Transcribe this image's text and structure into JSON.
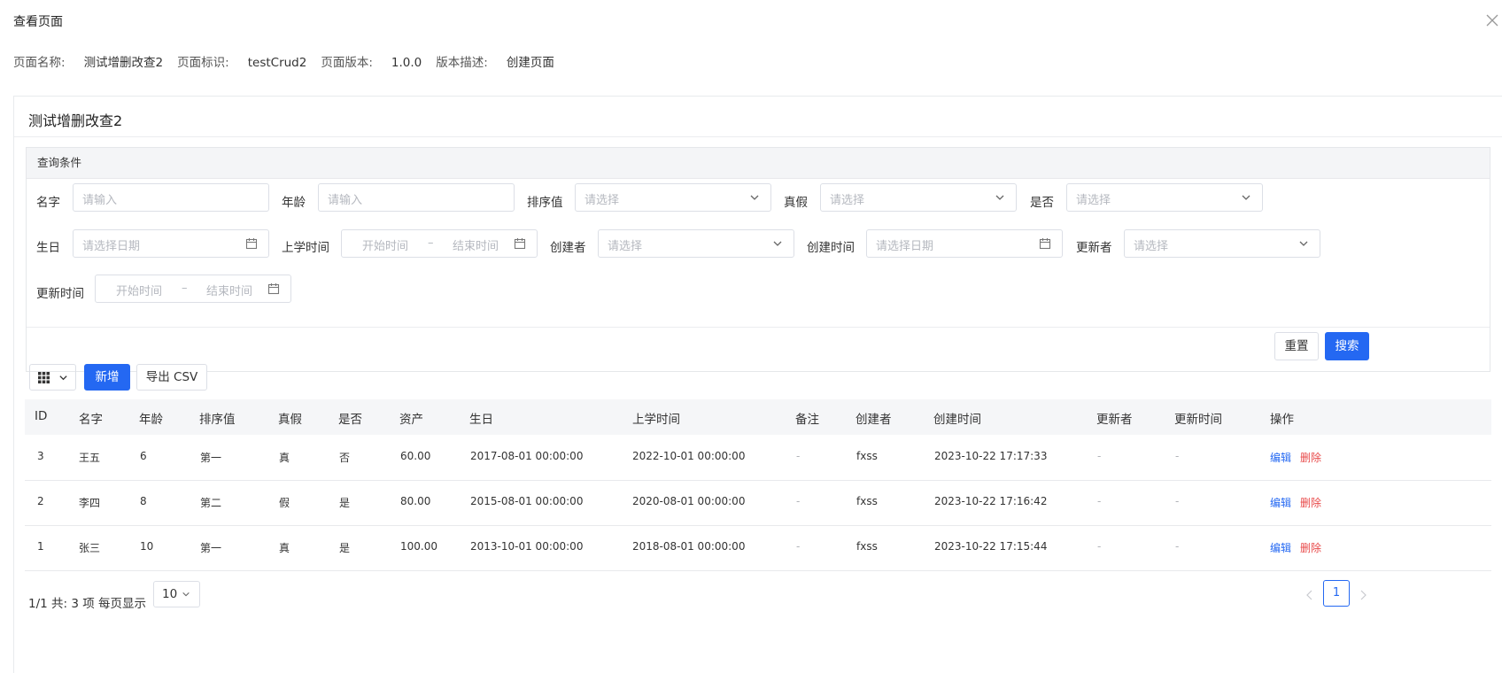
{
  "dialog": {
    "title": "查看页面"
  },
  "meta": {
    "name_label": "页面名称:",
    "name_value": "测试增删改查2",
    "id_label": "页面标识:",
    "id_value": "testCrud2",
    "version_label": "页面版本:",
    "version_value": "1.0.0",
    "desc_label": "版本描述:",
    "desc_value": "创建页面"
  },
  "card": {
    "title": "测试增删改查2"
  },
  "query": {
    "header": "查询条件",
    "fields": {
      "name": {
        "label": "名字",
        "placeholder": "请输入"
      },
      "age": {
        "label": "年龄",
        "placeholder": "请输入"
      },
      "sort": {
        "label": "排序值",
        "placeholder": "请选择"
      },
      "truefalse": {
        "label": "真假",
        "placeholder": "请选择"
      },
      "yesno": {
        "label": "是否",
        "placeholder": "请选择"
      },
      "birthday": {
        "label": "生日",
        "placeholder": "请选择日期"
      },
      "school_time": {
        "label": "上学时间",
        "start": "开始时间",
        "sep": "–",
        "end": "结束时间"
      },
      "creator": {
        "label": "创建者",
        "placeholder": "请选择"
      },
      "created_at": {
        "label": "创建时间",
        "placeholder": "请选择日期"
      },
      "updater": {
        "label": "更新者",
        "placeholder": "请选择"
      },
      "updated_at": {
        "label": "更新时间",
        "start": "开始时间",
        "sep": "–",
        "end": "结束时间"
      }
    },
    "reset_label": "重置",
    "search_label": "搜索"
  },
  "toolbar": {
    "add_label": "新增",
    "export_label": "导出 CSV"
  },
  "table": {
    "columns": [
      "ID",
      "名字",
      "年龄",
      "排序值",
      "真假",
      "是否",
      "资产",
      "生日",
      "上学时间",
      "备注",
      "创建者",
      "创建时间",
      "更新者",
      "更新时间",
      "操作"
    ],
    "rows": [
      {
        "id": "3",
        "name": "王五",
        "age": "6",
        "sort": "第一",
        "tf": "真",
        "yn": "否",
        "asset": "60.00",
        "birthday": "2017-08-01 00:00:00",
        "school": "2022-10-01 00:00:00",
        "remark": "-",
        "creator": "fxss",
        "created": "2023-10-22 17:17:33",
        "updater": "-",
        "updated": "-",
        "edit": "编辑",
        "del": "删除"
      },
      {
        "id": "2",
        "name": "李四",
        "age": "8",
        "sort": "第二",
        "tf": "假",
        "yn": "是",
        "asset": "80.00",
        "birthday": "2015-08-01 00:00:00",
        "school": "2020-08-01 00:00:00",
        "remark": "-",
        "creator": "fxss",
        "created": "2023-10-22 17:16:42",
        "updater": "-",
        "updated": "-",
        "edit": "编辑",
        "del": "删除"
      },
      {
        "id": "1",
        "name": "张三",
        "age": "10",
        "sort": "第一",
        "tf": "真",
        "yn": "是",
        "asset": "100.00",
        "birthday": "2013-10-01 00:00:00",
        "school": "2018-08-01 00:00:00",
        "remark": "-",
        "creator": "fxss",
        "created": "2023-10-22 17:15:44",
        "updater": "-",
        "updated": "-",
        "edit": "编辑",
        "del": "删除"
      }
    ]
  },
  "pagination": {
    "info": "1/1 共: 3 项  每页显示",
    "page_size": "10",
    "current_page": "1"
  },
  "colors": {
    "primary": "#2468f2",
    "danger": "#e84a4a"
  }
}
